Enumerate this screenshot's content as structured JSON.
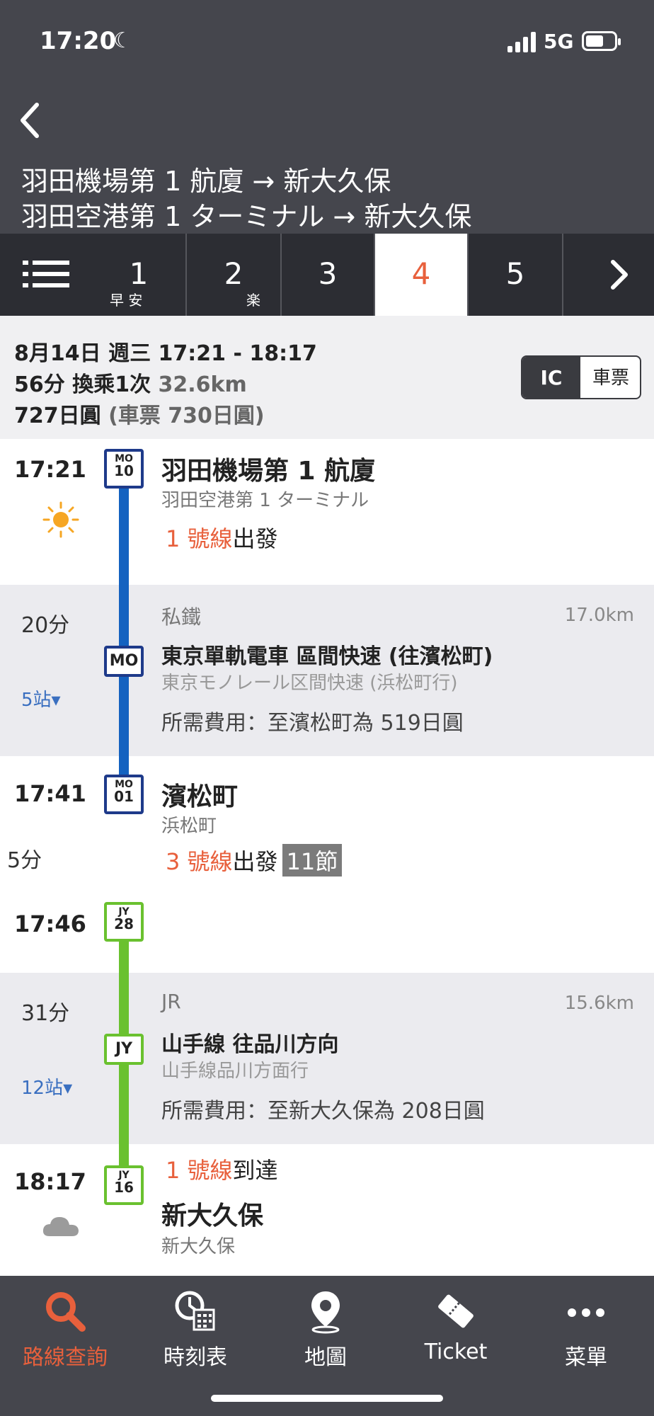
{
  "status_bar": {
    "time": "17:20",
    "network": "5G"
  },
  "header": {
    "title_line1": "羽田機場第 1 航廈 → 新大久保",
    "title_line2": "羽田空港第 1 ターミナル → 新大久保"
  },
  "tabs": [
    {
      "num": "1",
      "sub": "早 安"
    },
    {
      "num": "2",
      "sub": "楽"
    },
    {
      "num": "3",
      "sub": ""
    },
    {
      "num": "4",
      "sub": "",
      "active": true
    },
    {
      "num": "5",
      "sub": ""
    }
  ],
  "summary": {
    "line1": "8月14日 週三 17:21 - 18:17",
    "line2_main": "56分 換乘1次",
    "line2_dist": "32.6km",
    "line3_main": "727日圓",
    "line3_paren": "(車票 730日圓)",
    "toggle_ic": "IC",
    "toggle_ticket": "車票"
  },
  "segments": {
    "s1": {
      "time": "17:21",
      "weather_icon": "sun-icon",
      "badge_line": "MO",
      "badge_num": "10",
      "station": "羽田機場第 1 航廈",
      "station_jp": "羽田空港第 1 ターミナル",
      "platform": "1 號線",
      "platform_suffix": "出發"
    },
    "ride1": {
      "duration": "20分",
      "stops": "5站▾",
      "operator": "私鐵",
      "distance": "17.0km",
      "badge": "MO",
      "train": "東京單軌電車 區間快速 (往濱松町)",
      "train_jp": "東京モノレール区間快速 (浜松町行)",
      "fee": "所需費用：至濱松町為 519日圓"
    },
    "s2": {
      "time": "17:41",
      "badge_line": "MO",
      "badge_num": "01",
      "station": "濱松町",
      "station_jp": "浜松町",
      "transfer": "5分",
      "platform": "3 號線",
      "platform_suffix": "出發",
      "cars": "11節"
    },
    "s3": {
      "time": "17:46",
      "badge_line": "JY",
      "badge_num": "28"
    },
    "ride2": {
      "duration": "31分",
      "stops": "12站▾",
      "operator": "JR",
      "distance": "15.6km",
      "badge": "JY",
      "train": "山手線 往品川方向",
      "train_jp": "山手線品川方面行",
      "fee": "所需費用：至新大久保為 208日圓"
    },
    "s4": {
      "time": "18:17",
      "weather_icon": "cloud-icon",
      "badge_line": "JY",
      "badge_num": "16",
      "platform": "1 號線",
      "platform_suffix": "到達",
      "station": "新大久保",
      "station_jp": "新大久保"
    }
  },
  "bottom_nav": [
    {
      "label": "路線查詢",
      "icon": "search-icon",
      "active": true
    },
    {
      "label": "時刻表",
      "icon": "timetable-icon"
    },
    {
      "label": "地圖",
      "icon": "map-pin-icon"
    },
    {
      "label": "Ticket",
      "icon": "ticket-icon"
    },
    {
      "label": "菜單",
      "icon": "more-icon"
    }
  ],
  "colors": {
    "accent": "#e8603c",
    "header": "#45464d",
    "monorail": "#1462c0",
    "jr_yamanote": "#6ac12f"
  }
}
